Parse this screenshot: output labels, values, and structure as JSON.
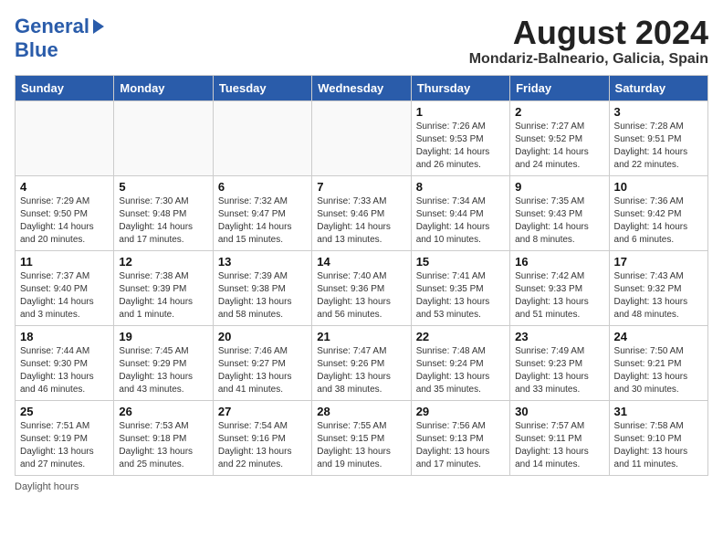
{
  "header": {
    "logo_line1": "General",
    "logo_line2": "Blue",
    "month_title": "August 2024",
    "location": "Mondariz-Balneario, Galicia, Spain"
  },
  "weekdays": [
    "Sunday",
    "Monday",
    "Tuesday",
    "Wednesday",
    "Thursday",
    "Friday",
    "Saturday"
  ],
  "weeks": [
    [
      {
        "day": "",
        "info": ""
      },
      {
        "day": "",
        "info": ""
      },
      {
        "day": "",
        "info": ""
      },
      {
        "day": "",
        "info": ""
      },
      {
        "day": "1",
        "sunrise": "7:26 AM",
        "sunset": "9:53 PM",
        "daylight": "14 hours and 26 minutes."
      },
      {
        "day": "2",
        "sunrise": "7:27 AM",
        "sunset": "9:52 PM",
        "daylight": "14 hours and 24 minutes."
      },
      {
        "day": "3",
        "sunrise": "7:28 AM",
        "sunset": "9:51 PM",
        "daylight": "14 hours and 22 minutes."
      }
    ],
    [
      {
        "day": "4",
        "sunrise": "7:29 AM",
        "sunset": "9:50 PM",
        "daylight": "14 hours and 20 minutes."
      },
      {
        "day": "5",
        "sunrise": "7:30 AM",
        "sunset": "9:48 PM",
        "daylight": "14 hours and 17 minutes."
      },
      {
        "day": "6",
        "sunrise": "7:32 AM",
        "sunset": "9:47 PM",
        "daylight": "14 hours and 15 minutes."
      },
      {
        "day": "7",
        "sunrise": "7:33 AM",
        "sunset": "9:46 PM",
        "daylight": "14 hours and 13 minutes."
      },
      {
        "day": "8",
        "sunrise": "7:34 AM",
        "sunset": "9:44 PM",
        "daylight": "14 hours and 10 minutes."
      },
      {
        "day": "9",
        "sunrise": "7:35 AM",
        "sunset": "9:43 PM",
        "daylight": "14 hours and 8 minutes."
      },
      {
        "day": "10",
        "sunrise": "7:36 AM",
        "sunset": "9:42 PM",
        "daylight": "14 hours and 6 minutes."
      }
    ],
    [
      {
        "day": "11",
        "sunrise": "7:37 AM",
        "sunset": "9:40 PM",
        "daylight": "14 hours and 3 minutes."
      },
      {
        "day": "12",
        "sunrise": "7:38 AM",
        "sunset": "9:39 PM",
        "daylight": "14 hours and 1 minute."
      },
      {
        "day": "13",
        "sunrise": "7:39 AM",
        "sunset": "9:38 PM",
        "daylight": "13 hours and 58 minutes."
      },
      {
        "day": "14",
        "sunrise": "7:40 AM",
        "sunset": "9:36 PM",
        "daylight": "13 hours and 56 minutes."
      },
      {
        "day": "15",
        "sunrise": "7:41 AM",
        "sunset": "9:35 PM",
        "daylight": "13 hours and 53 minutes."
      },
      {
        "day": "16",
        "sunrise": "7:42 AM",
        "sunset": "9:33 PM",
        "daylight": "13 hours and 51 minutes."
      },
      {
        "day": "17",
        "sunrise": "7:43 AM",
        "sunset": "9:32 PM",
        "daylight": "13 hours and 48 minutes."
      }
    ],
    [
      {
        "day": "18",
        "sunrise": "7:44 AM",
        "sunset": "9:30 PM",
        "daylight": "13 hours and 46 minutes."
      },
      {
        "day": "19",
        "sunrise": "7:45 AM",
        "sunset": "9:29 PM",
        "daylight": "13 hours and 43 minutes."
      },
      {
        "day": "20",
        "sunrise": "7:46 AM",
        "sunset": "9:27 PM",
        "daylight": "13 hours and 41 minutes."
      },
      {
        "day": "21",
        "sunrise": "7:47 AM",
        "sunset": "9:26 PM",
        "daylight": "13 hours and 38 minutes."
      },
      {
        "day": "22",
        "sunrise": "7:48 AM",
        "sunset": "9:24 PM",
        "daylight": "13 hours and 35 minutes."
      },
      {
        "day": "23",
        "sunrise": "7:49 AM",
        "sunset": "9:23 PM",
        "daylight": "13 hours and 33 minutes."
      },
      {
        "day": "24",
        "sunrise": "7:50 AM",
        "sunset": "9:21 PM",
        "daylight": "13 hours and 30 minutes."
      }
    ],
    [
      {
        "day": "25",
        "sunrise": "7:51 AM",
        "sunset": "9:19 PM",
        "daylight": "13 hours and 27 minutes."
      },
      {
        "day": "26",
        "sunrise": "7:53 AM",
        "sunset": "9:18 PM",
        "daylight": "13 hours and 25 minutes."
      },
      {
        "day": "27",
        "sunrise": "7:54 AM",
        "sunset": "9:16 PM",
        "daylight": "13 hours and 22 minutes."
      },
      {
        "day": "28",
        "sunrise": "7:55 AM",
        "sunset": "9:15 PM",
        "daylight": "13 hours and 19 minutes."
      },
      {
        "day": "29",
        "sunrise": "7:56 AM",
        "sunset": "9:13 PM",
        "daylight": "13 hours and 17 minutes."
      },
      {
        "day": "30",
        "sunrise": "7:57 AM",
        "sunset": "9:11 PM",
        "daylight": "13 hours and 14 minutes."
      },
      {
        "day": "31",
        "sunrise": "7:58 AM",
        "sunset": "9:10 PM",
        "daylight": "13 hours and 11 minutes."
      }
    ]
  ],
  "footer": {
    "daylight_label": "Daylight hours"
  }
}
